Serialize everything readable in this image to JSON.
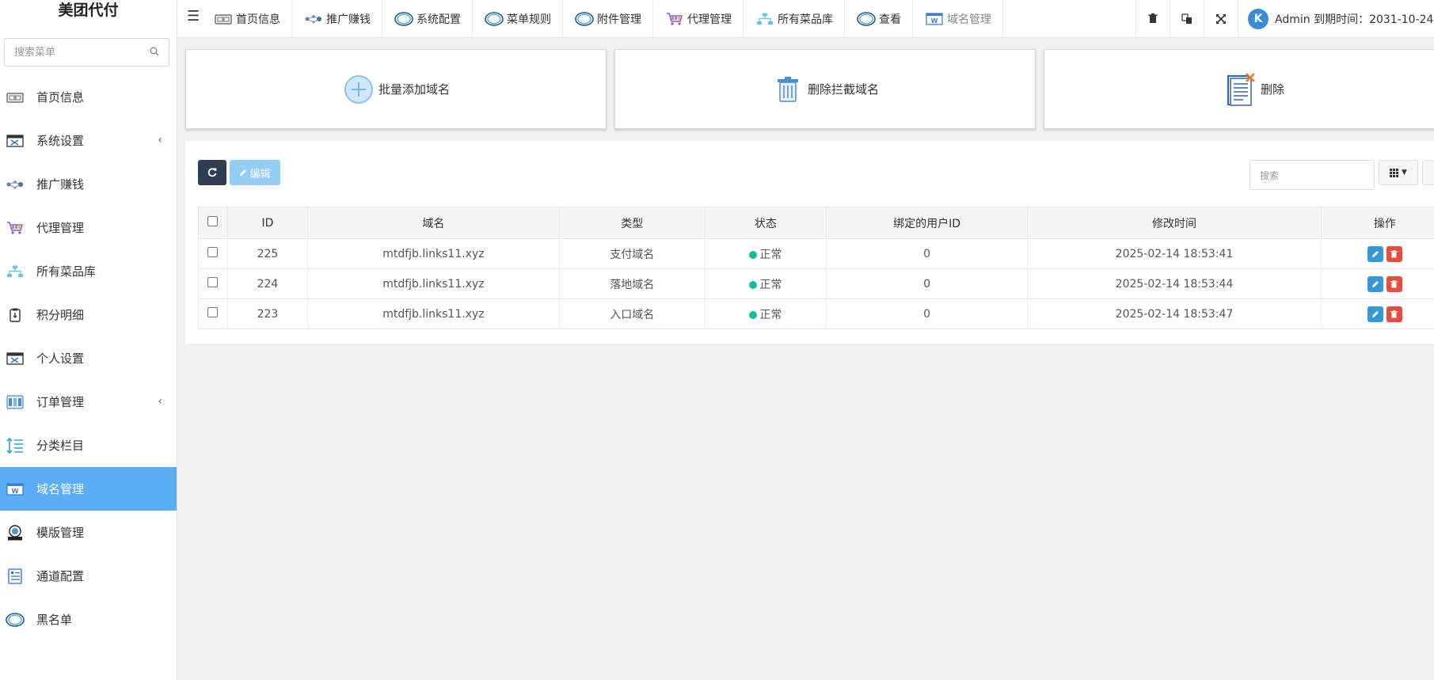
{
  "app": {
    "title": "美团代付"
  },
  "sidebar": {
    "search_placeholder": "搜索菜单",
    "items": [
      {
        "label": "首页信息",
        "icon": "cash-icon",
        "has_arrow": false
      },
      {
        "label": "系统设置",
        "icon": "window-tools-icon",
        "has_arrow": true,
        "arrow": "‹"
      },
      {
        "label": "推广赚钱",
        "icon": "share-network-icon",
        "has_arrow": false
      },
      {
        "label": "代理管理",
        "icon": "cart-icon",
        "has_arrow": false
      },
      {
        "label": "所有菜品库",
        "icon": "sitemap-icon",
        "has_arrow": false
      },
      {
        "label": "积分明细",
        "icon": "clipboard-icon",
        "has_arrow": false
      },
      {
        "label": "个人设置",
        "icon": "window-tools-icon",
        "has_arrow": false
      },
      {
        "label": "订单管理",
        "icon": "orders-icon",
        "has_arrow": true,
        "arrow": "‹"
      },
      {
        "label": "分类栏目",
        "icon": "sort-list-icon",
        "has_arrow": false
      },
      {
        "label": "域名管理",
        "icon": "www-icon",
        "has_arrow": false,
        "active": true
      },
      {
        "label": "模版管理",
        "icon": "html-globe-icon",
        "has_arrow": false
      },
      {
        "label": "通道配置",
        "icon": "form-icon",
        "has_arrow": false
      },
      {
        "label": "黑名单",
        "icon": "ring-icon",
        "has_arrow": false
      }
    ]
  },
  "topbar": {
    "tabs": [
      {
        "label": "首页信息",
        "icon": "cash-icon"
      },
      {
        "label": "推广赚钱",
        "icon": "share-network-icon"
      },
      {
        "label": "系统配置",
        "icon": "ring-icon"
      },
      {
        "label": "菜单规则",
        "icon": "ring-icon"
      },
      {
        "label": "附件管理",
        "icon": "ring-icon"
      },
      {
        "label": "代理管理",
        "icon": "cart-icon"
      },
      {
        "label": "所有菜品库",
        "icon": "sitemap-icon"
      },
      {
        "label": "查看",
        "icon": "ring-icon"
      },
      {
        "label": "域名管理",
        "icon": "www-icon",
        "current": true
      }
    ],
    "user_text": "Admin 到期时间：2031-10-24"
  },
  "actions": [
    {
      "label": "批量添加域名",
      "icon": "add-circle-icon"
    },
    {
      "label": "删除拦截域名",
      "icon": "trash-icon"
    },
    {
      "label": "删除",
      "icon": "delete-document-icon"
    }
  ],
  "table": {
    "edit_label": "编辑",
    "search_placeholder": "搜索",
    "columns": [
      "ID",
      "域名",
      "类型",
      "状态",
      "绑定的用户ID",
      "修改时间",
      "操作"
    ],
    "rows": [
      {
        "id": "225",
        "domain": "mtdfjb.links11.xyz",
        "type": "支付域名",
        "type_class": "type-pay",
        "status": "正常",
        "user_id": "0",
        "time": "2025-02-14 18:53:41"
      },
      {
        "id": "224",
        "domain": "mtdfjb.links11.xyz",
        "type": "落地域名",
        "type_class": "type-land",
        "status": "正常",
        "user_id": "0",
        "time": "2025-02-14 18:53:44"
      },
      {
        "id": "223",
        "domain": "mtdfjb.links11.xyz",
        "type": "入口域名",
        "type_class": "type-entry",
        "status": "正常",
        "user_id": "0",
        "time": "2025-02-14 18:53:47"
      }
    ]
  },
  "colors": {
    "active": "#5aaef6",
    "pay": "#e74c3c",
    "ok": "#18bc9c",
    "dark_btn": "#2c3e50"
  }
}
